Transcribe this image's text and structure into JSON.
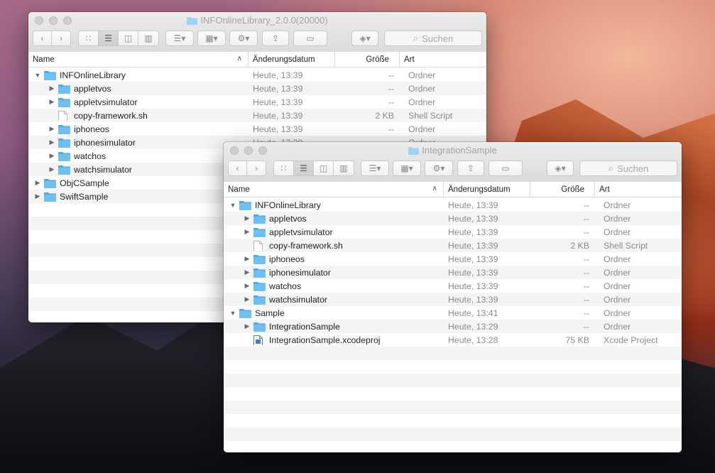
{
  "colors": {
    "folder": "#6fc0f0",
    "folder_tab": "#4aa8e2",
    "text_muted": "#8b8b8b"
  },
  "columns": {
    "name": "Name",
    "date": "Änderungsdatum",
    "size": "Größe",
    "kind": "Art"
  },
  "search_placeholder": "Suchen",
  "windows": {
    "back": {
      "title": "INFOnlineLibrary_2.0.0(20000)",
      "rows": [
        {
          "level": 0,
          "disclosure": "open",
          "icon": "folder-icon",
          "name": "INFOnlineLibrary",
          "date": "Heute, 13:39",
          "size": "--",
          "kind": "Ordner"
        },
        {
          "level": 1,
          "disclosure": "closed",
          "icon": "folder-icon",
          "name": "appletvos",
          "date": "Heute, 13:39",
          "size": "--",
          "kind": "Ordner"
        },
        {
          "level": 1,
          "disclosure": "closed",
          "icon": "folder-icon",
          "name": "appletvsimulator",
          "date": "Heute, 13:39",
          "size": "--",
          "kind": "Ordner"
        },
        {
          "level": 1,
          "disclosure": "none",
          "icon": "file-icon",
          "name": "copy-framework.sh",
          "date": "Heute, 13:39",
          "size": "2 KB",
          "kind": "Shell Script"
        },
        {
          "level": 1,
          "disclosure": "closed",
          "icon": "folder-icon",
          "name": "iphoneos",
          "date": "Heute, 13:39",
          "size": "--",
          "kind": "Ordner"
        },
        {
          "level": 1,
          "disclosure": "closed",
          "icon": "folder-icon",
          "name": "iphonesimulator",
          "date": "Heute, 13:39",
          "size": "--",
          "kind": "Ordner"
        },
        {
          "level": 1,
          "disclosure": "closed",
          "icon": "folder-icon",
          "name": "watchos",
          "date": "",
          "size": "",
          "kind": ""
        },
        {
          "level": 1,
          "disclosure": "closed",
          "icon": "folder-icon",
          "name": "watchsimulator",
          "date": "",
          "size": "",
          "kind": ""
        },
        {
          "level": 0,
          "disclosure": "closed",
          "icon": "folder-icon",
          "name": "ObjCSample",
          "date": "",
          "size": "",
          "kind": ""
        },
        {
          "level": 0,
          "disclosure": "closed",
          "icon": "folder-icon",
          "name": "SwiftSample",
          "date": "",
          "size": "",
          "kind": ""
        }
      ]
    },
    "front": {
      "title": "IntegrationSample",
      "rows": [
        {
          "level": 0,
          "disclosure": "open",
          "icon": "folder-icon",
          "name": "INFOnlineLibrary",
          "date": "Heute, 13:39",
          "size": "--",
          "kind": "Ordner"
        },
        {
          "level": 1,
          "disclosure": "closed",
          "icon": "folder-icon",
          "name": "appletvos",
          "date": "Heute, 13:39",
          "size": "--",
          "kind": "Ordner"
        },
        {
          "level": 1,
          "disclosure": "closed",
          "icon": "folder-icon",
          "name": "appletvsimulator",
          "date": "Heute, 13:39",
          "size": "--",
          "kind": "Ordner"
        },
        {
          "level": 1,
          "disclosure": "none",
          "icon": "file-icon",
          "name": "copy-framework.sh",
          "date": "Heute, 13:39",
          "size": "2 KB",
          "kind": "Shell Script"
        },
        {
          "level": 1,
          "disclosure": "closed",
          "icon": "folder-icon",
          "name": "iphoneos",
          "date": "Heute, 13:39",
          "size": "--",
          "kind": "Ordner"
        },
        {
          "level": 1,
          "disclosure": "closed",
          "icon": "folder-icon",
          "name": "iphonesimulator",
          "date": "Heute, 13:39",
          "size": "--",
          "kind": "Ordner"
        },
        {
          "level": 1,
          "disclosure": "closed",
          "icon": "folder-icon",
          "name": "watchos",
          "date": "Heute, 13:39",
          "size": "--",
          "kind": "Ordner"
        },
        {
          "level": 1,
          "disclosure": "closed",
          "icon": "folder-icon",
          "name": "watchsimulator",
          "date": "Heute, 13:39",
          "size": "--",
          "kind": "Ordner"
        },
        {
          "level": 0,
          "disclosure": "open",
          "icon": "folder-icon",
          "name": "Sample",
          "date": "Heute, 13:41",
          "size": "--",
          "kind": "Ordner"
        },
        {
          "level": 1,
          "disclosure": "closed",
          "icon": "folder-icon",
          "name": "IntegrationSample",
          "date": "Heute, 13:29",
          "size": "--",
          "kind": "Ordner"
        },
        {
          "level": 1,
          "disclosure": "none",
          "icon": "xcodeproj-icon",
          "name": "IntegrationSample.xcodeproj",
          "date": "Heute, 13:28",
          "size": "75 KB",
          "kind": "Xcode Project"
        }
      ]
    }
  }
}
